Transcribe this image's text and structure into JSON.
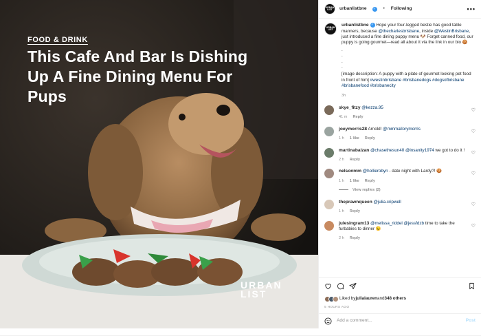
{
  "photo": {
    "kicker": "FOOD & DRINK",
    "headline": "This Cafe And Bar Is Dishing Up A Fine Dining Menu For Pups",
    "brand_line1": "URBAN",
    "brand_line2": "LIST"
  },
  "header": {
    "avatar_text": "URBAN LIST",
    "username": "urbanlistbne",
    "separator": "•",
    "follow_label": "Following",
    "more": "•••"
  },
  "caption": {
    "username": "urbanlistbne",
    "text1": " Hope your four-legged bestie has good table manners, because ",
    "link1": "@thecharlesbrisbane",
    "text2": ", inside ",
    "link2": "@WestinBrisbane",
    "text3": ", just introduced a fine dining puppy menu 🐶 Forget canned food, our puppy is going gourmet—read all about it via the link in our bio 🍪",
    "dots": ".\n.\n.\n.",
    "text4": "[image description: A puppy with a plate of gourmet looking pet food in front of him] ",
    "tags": "#westinbrisbane #brisbanedogs #dogsofbrisbane #brisbanefood #brisbanecity",
    "time": "3h"
  },
  "comments": [
    {
      "user": "skye_fitzy",
      "mention": "@kezza.95",
      "text": "",
      "time": "41 m",
      "likes": "",
      "reply": "Reply",
      "color": "#7a6a5a"
    },
    {
      "user": "joeymorris28",
      "mention": "",
      "text": " Arnold! ",
      "mention2": "@mmmallorymorris",
      "time": "1 h",
      "likes": "1 like",
      "reply": "Reply",
      "color": "#9aa4a0"
    },
    {
      "user": "martinabalzan",
      "mention": "@chasethesun40",
      "text": " ",
      "mention2": "@insanity1974",
      "text2": " we got to do it !",
      "time": "2 h",
      "likes": "",
      "reply": "Reply",
      "color": "#6b7c6a"
    },
    {
      "user": "nelsonmm",
      "mention": "@hollierobyn",
      "text": " - date night with Lardy?! 🍪",
      "time": "1 h",
      "likes": "1 like",
      "reply": "Reply",
      "color": "#a08a80"
    },
    {
      "user": "theprawnqueen",
      "mention": "@julia.cripwell",
      "text": "",
      "time": "1 h",
      "likes": "",
      "reply": "Reply",
      "color": "#d8c8b8"
    },
    {
      "user": "julesingram13",
      "mention": "@melissa_riddel",
      "text": " ",
      "mention2": "@jessfdzb",
      "text2": " time to take the furbabies to dinner 😉",
      "time": "2 h",
      "likes": "",
      "reply": "Reply",
      "color": "#c88a60"
    }
  ],
  "view_replies": "View replies (2)",
  "likes": {
    "prefix": "Liked by ",
    "user": "julialauren",
    "mid": " and ",
    "count": "348 others"
  },
  "time_ago": "5 HOURS AGO",
  "add_comment": {
    "placeholder": "Add a comment...",
    "post": "Post"
  },
  "colors": {
    "link": "#00376b",
    "verified": "#3897f0",
    "muted": "#8e8e8e"
  }
}
